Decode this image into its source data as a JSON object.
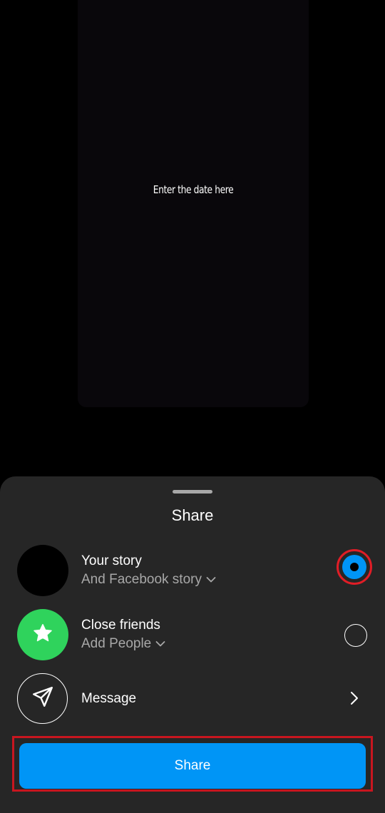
{
  "story": {
    "text": "Enter the date here"
  },
  "sheet": {
    "title": "Share",
    "options": [
      {
        "title": "Your story",
        "subtitle": "And Facebook story",
        "selected": true
      },
      {
        "title": "Close friends",
        "subtitle": "Add People",
        "selected": false
      },
      {
        "title": "Message"
      }
    ],
    "share_button_label": "Share"
  },
  "colors": {
    "accent_blue": "#0095f6",
    "close_friends_green": "#2fd35c",
    "highlight_red": "#c8161f",
    "sheet_background": "#262626"
  },
  "icons": {
    "close_friends": "star-icon",
    "message": "paper-plane-icon",
    "expand": "chevron-down-icon",
    "navigate": "chevron-right-icon"
  }
}
